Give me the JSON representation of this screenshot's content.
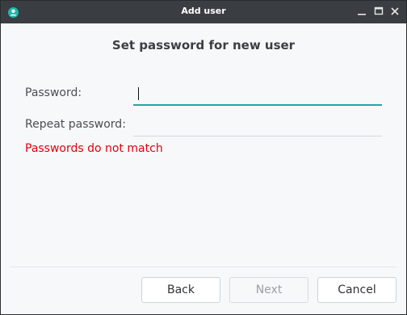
{
  "window": {
    "title": "Add user",
    "app_icon": "user-icon",
    "controls": [
      "minimize-icon",
      "maximize-icon",
      "close-icon"
    ]
  },
  "dialog": {
    "heading": "Set password for new user",
    "fields": {
      "password": {
        "label": "Password:",
        "value": ""
      },
      "repeat_password": {
        "label": "Repeat password:",
        "value": ""
      }
    },
    "error": "Passwords do not match"
  },
  "buttons": {
    "back": "Back",
    "next": "Next",
    "cancel": "Cancel"
  },
  "colors": {
    "accent": "#1fa8a0",
    "error": "#e0000a",
    "titlebar": "#3a3d42"
  }
}
